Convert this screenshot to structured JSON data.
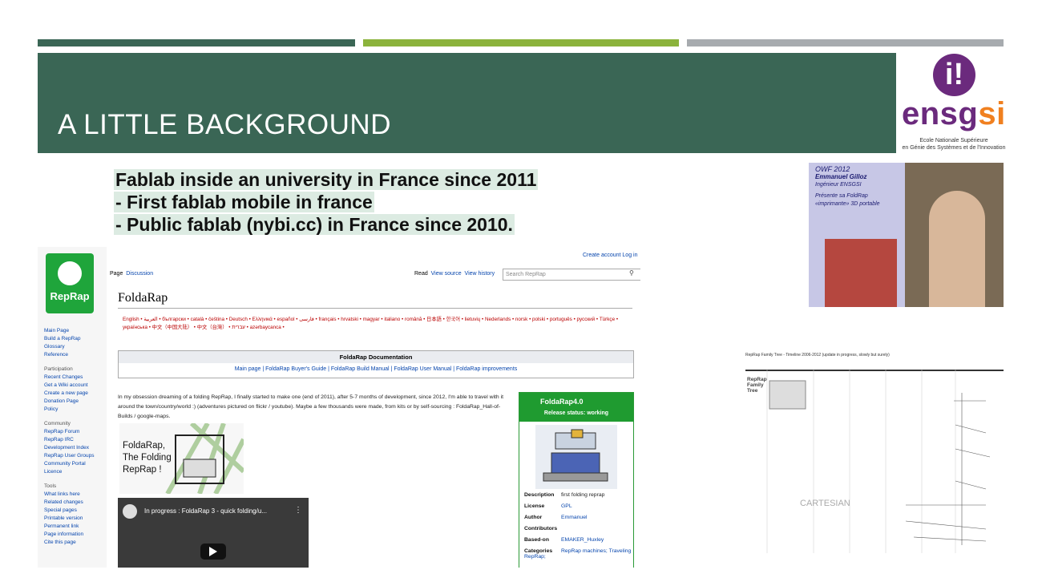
{
  "slide": {
    "title": "A LITTLE BACKGROUND",
    "accent_colors": [
      "#3a6655",
      "#8bb33c",
      "#a7abaf"
    ],
    "bullets": [
      "Fablab inside an university in France since 2011",
      "- First fablab mobile in france",
      "- Public fablab (nybi.cc) in France since 2010."
    ]
  },
  "logo": {
    "mark": "i!",
    "word_purple": "ensg",
    "word_orange": "si",
    "subtitle_line1": "Ecole Nationale Supérieure",
    "subtitle_line2": "en Génie des Systèmes et de l'Innovation"
  },
  "wiki": {
    "logo_text": "RepRap",
    "top_links": "Create account  Log in",
    "tab_page": "Page",
    "tab_discussion": "Discussion",
    "tab_read": "Read",
    "tab_view_source": "View source",
    "tab_view_history": "View history",
    "search_placeholder": "Search RepRap",
    "page_title": "FoldaRap",
    "languages": "English • العربية • български • català • čeština • Deutsch • Ελληνικά • español • فارسی • français • hrvatski • magyar • italiano • română • 日本語 • 한국어 • lietuvių • Nederlands • norsk • polski • português • русский • Türkçe • українська • 中文（中国大陆） • 中文（台灣） • עברית • azərbaycanca •",
    "doc_header": "FoldaRap Documentation",
    "doc_links": "Main page | FoldaRap Buyer's Guide | FoldaRap Build Manual | FoldaRap User Manual | FoldaRap improvements",
    "intro_text": "In my obsession dreaming of a folding RepRap, I finally started to make one (end of 2011), after 5-7 months of development, since 2012, I'm able to travel with it around the town/country/world :) (adventures pictured on flickr / youtube). Maybe a few thousands were made, from kits or by self-sourcing : FoldaRap_Hall-of-Builds / google-maps.",
    "image_caption": "FoldaRap, The Folding RepRap !",
    "video_title": "In progress : FoldaRap 3 - quick folding/u...",
    "sidebar": {
      "nav": [
        "Main Page",
        "Build a RepRap",
        "Glossary",
        "Reference"
      ],
      "participation_head": "Participation",
      "participation": [
        "Recent Changes",
        "Get a Wiki account",
        "Create a new page",
        "Donation Page",
        "Policy"
      ],
      "community_head": "Community",
      "community": [
        "RepRap Forum",
        "RepRap IRC",
        "Development Index",
        "RepRap User Groups",
        "Community Portal",
        "Licence"
      ],
      "tools_head": "Tools",
      "tools": [
        "What links here",
        "Related changes",
        "Special pages",
        "Printable version",
        "Permanent link",
        "Page information",
        "Cite this page"
      ]
    },
    "infobox": {
      "name": "FoldaRap4.0",
      "status": "Release status: working",
      "rows": [
        {
          "k": "Description",
          "v": "first folding reprap"
        },
        {
          "k": "License",
          "v": "GPL"
        },
        {
          "k": "Author",
          "v": "Emmanuel"
        },
        {
          "k": "Contributors",
          "v": ""
        },
        {
          "k": "Based-on",
          "v": "EMAKER_Huxley"
        },
        {
          "k": "Categories",
          "v": "RepRap machines; Traveling RepRap;"
        }
      ]
    }
  },
  "photo": {
    "line1": "OWF 2012",
    "line2": "Emmanuel Gilloz",
    "line3": "Ingénieur ENSGSI",
    "line4": "Présente sa FoldRap",
    "line5": "«imprimante» 3D portable"
  },
  "tree": {
    "title": "RepRap Family Tree - Timeline 2006-2012 (update in progress, slowly but surely)",
    "label_family": "RepRap Family Tree",
    "label_cartesian": "CARTESIAN"
  }
}
